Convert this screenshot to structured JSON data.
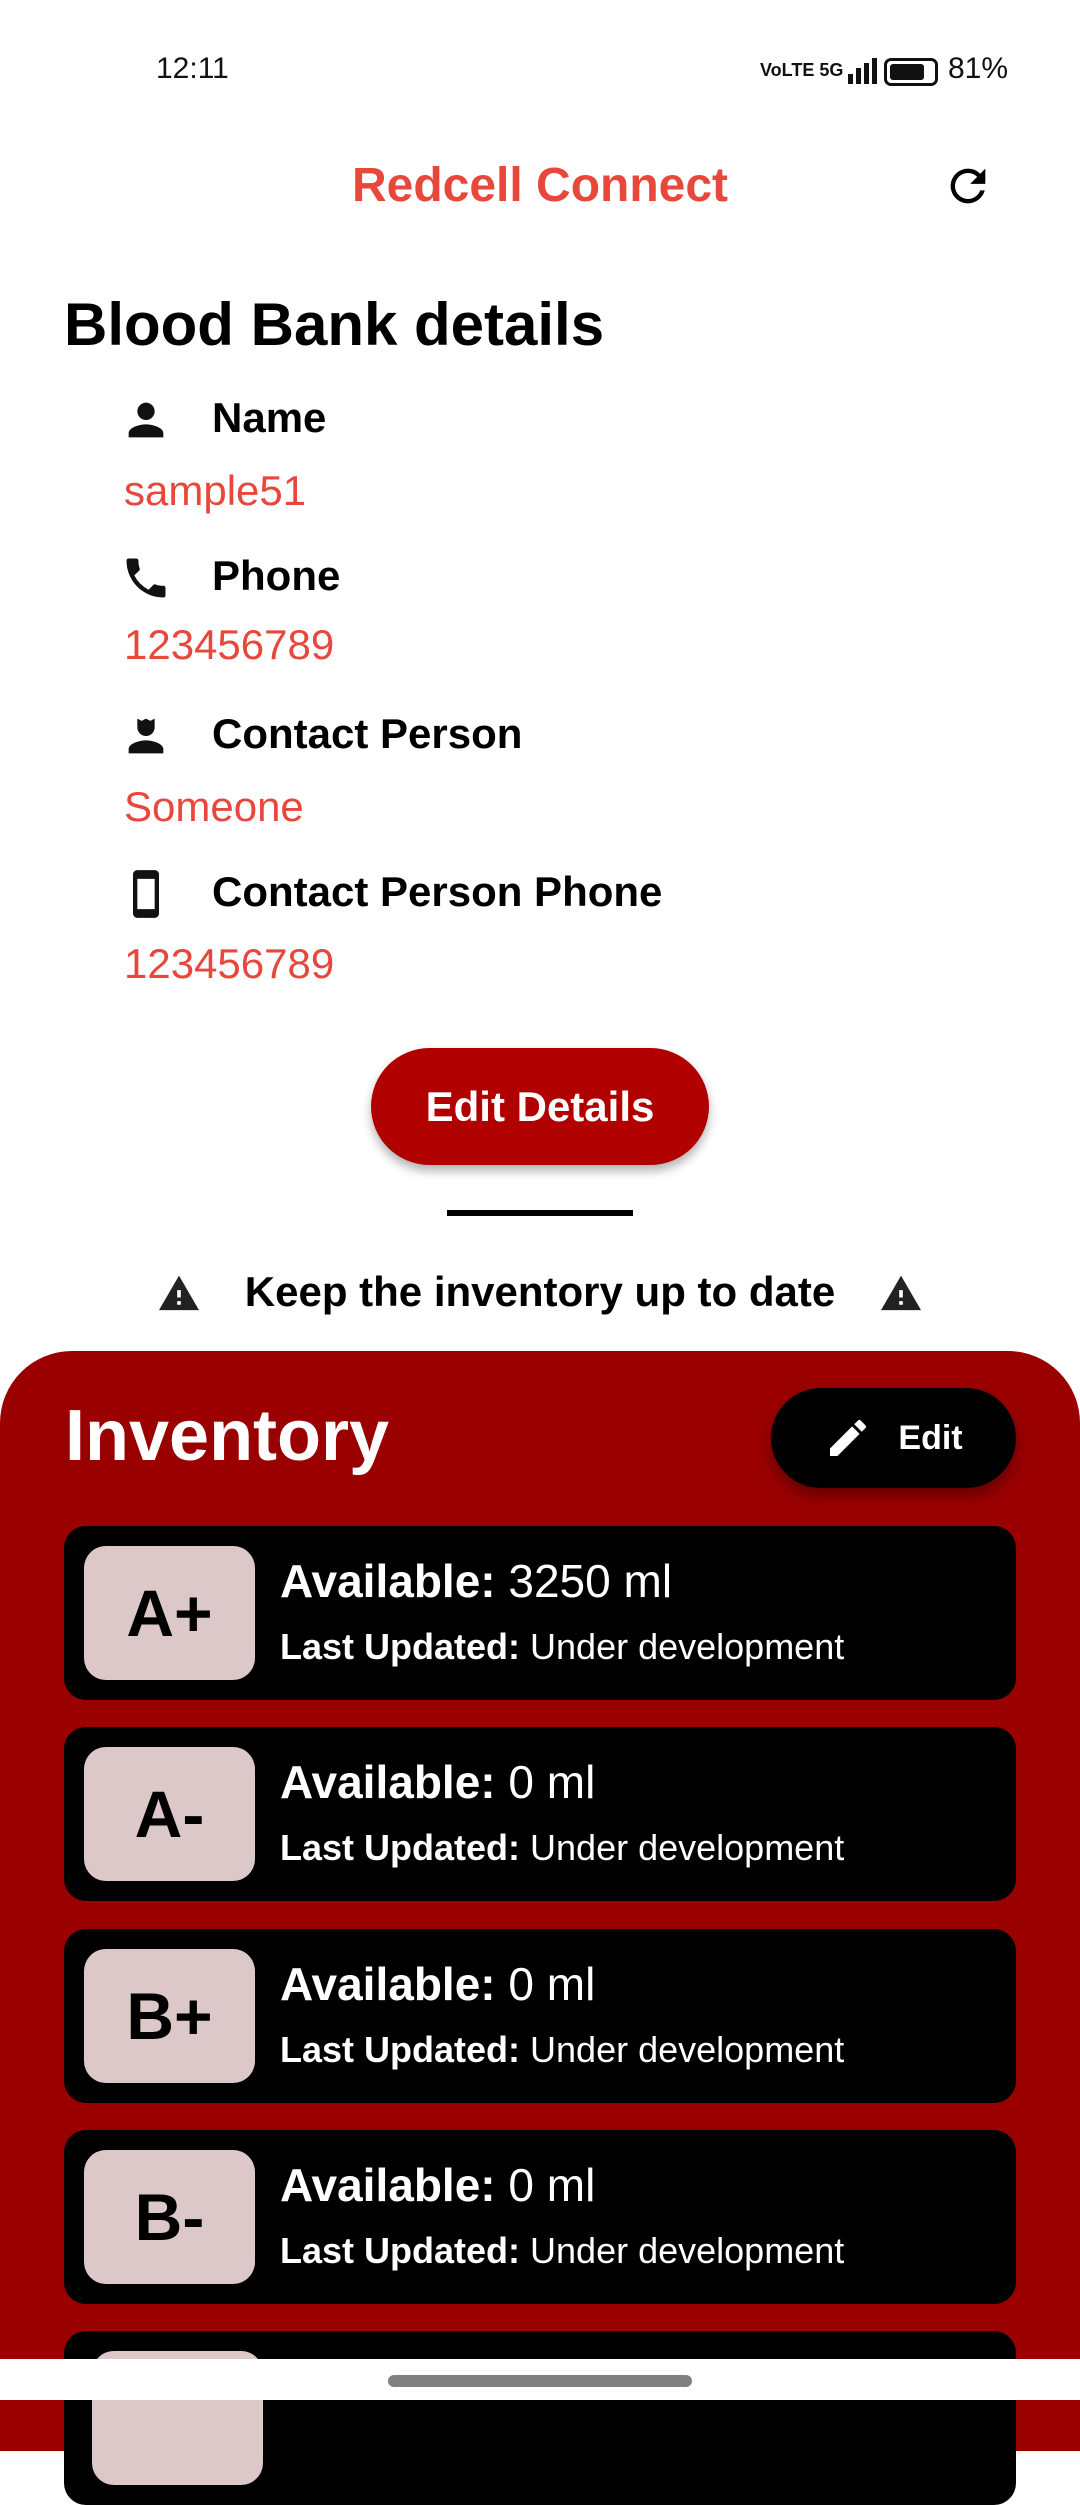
{
  "status_bar": {
    "time": "12:11",
    "network": "VoLTE 5G",
    "battery": "81%"
  },
  "app_bar": {
    "title": "Redcell Connect",
    "refresh_icon": "refresh-icon"
  },
  "details": {
    "heading": "Blood Bank details",
    "fields": [
      {
        "label": "Name",
        "value": "sample51",
        "icon": "person-icon"
      },
      {
        "label": "Phone",
        "value": "123456789",
        "icon": "phone-icon"
      },
      {
        "label": "Contact Person",
        "value": "Someone",
        "icon": "contact-person-icon"
      },
      {
        "label": "Contact Person Phone",
        "value": "123456789",
        "icon": "smartphone-icon"
      }
    ],
    "edit_button": "Edit Details"
  },
  "warning": {
    "text": "Keep the inventory up to date"
  },
  "inventory": {
    "title": "Inventory",
    "edit_label": "Edit",
    "available_label": "Available:",
    "updated_label": "Last Updated:",
    "items": [
      {
        "group": "A+",
        "available": "3250 ml",
        "updated": "Under development"
      },
      {
        "group": "A-",
        "available": "0 ml",
        "updated": "Under development"
      },
      {
        "group": "B+",
        "available": "0 ml",
        "updated": "Under development"
      },
      {
        "group": "B-",
        "available": "0 ml",
        "updated": "Under development"
      }
    ]
  },
  "colors": {
    "accent": "#e8473b",
    "button": "#b00000",
    "panel": "#9b0000",
    "badge": "#dcc8c8"
  }
}
